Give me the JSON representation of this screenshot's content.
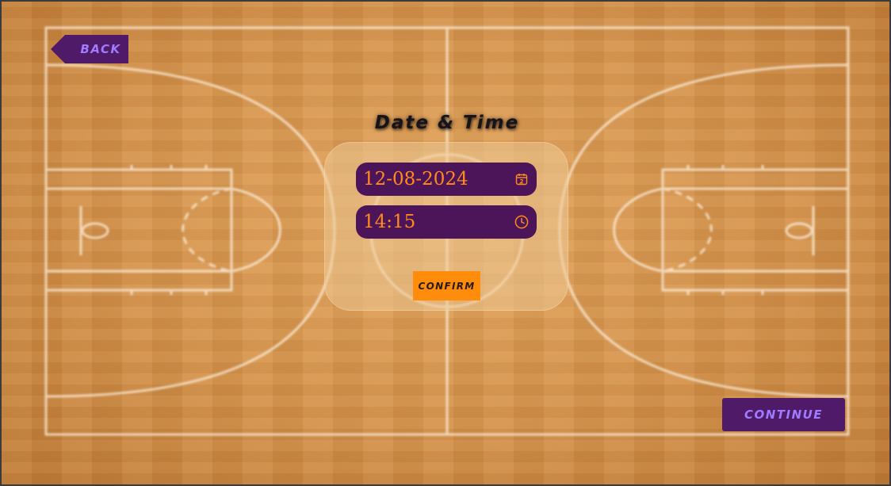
{
  "screen": {
    "title": "Date & Time"
  },
  "navigation": {
    "back_label": "BACK",
    "continue_label": "CONTINUE"
  },
  "form": {
    "date_value": "12-08-2024",
    "date_icon": "calendar-icon",
    "time_value": "14:15",
    "time_icon": "clock-icon",
    "confirm_label": "CONFIRM"
  },
  "colors": {
    "primary_purple": "#4f1a67",
    "accent_orange": "#ff8c0a",
    "button_text": "#9e7bff"
  }
}
